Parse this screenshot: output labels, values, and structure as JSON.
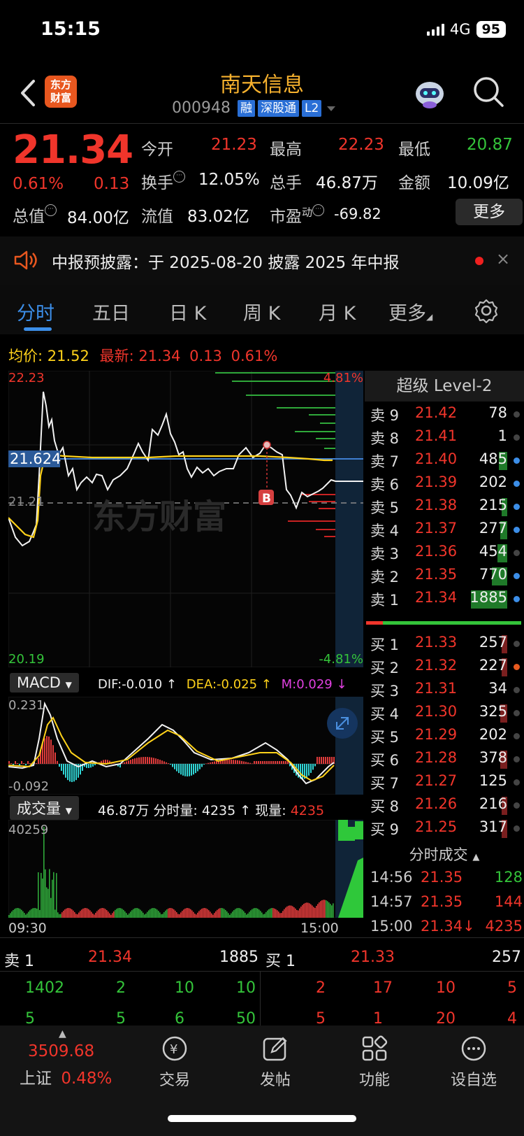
{
  "status": {
    "time": "15:15",
    "network": "4G",
    "battery": "95"
  },
  "header": {
    "logo_line1": "东方",
    "logo_line2": "财富",
    "stock_name": "南天信息",
    "stock_code": "000948",
    "tags": [
      "融",
      "深股通",
      "L2"
    ]
  },
  "quote": {
    "price": "21.34",
    "pct": "0.61%",
    "change": "0.13",
    "open_label": "今开",
    "open": "21.23",
    "high_label": "最高",
    "high": "22.23",
    "low_label": "最低",
    "low": "20.87",
    "turnover_label": "换手",
    "turnover": "12.05%",
    "vol_label": "总手",
    "vol": "46.87万",
    "amount_label": "金额",
    "amount": "10.09亿",
    "mktcap_label": "总值",
    "mktcap": "84.00亿",
    "float_label": "流值",
    "float": "83.02亿",
    "pe_label": "市盈",
    "pe_sup": "动",
    "pe": "-69.82",
    "more_label": "更多"
  },
  "notice": {
    "text": "中报预披露：于 2025-08-20 披露 2025 年中报",
    "close": "×"
  },
  "tabs": [
    "分时",
    "五日",
    "日 K",
    "周 K",
    "月 K",
    "更多"
  ],
  "stats": {
    "avg_label": "均价:",
    "avg": "21.52",
    "latest_label": "最新:",
    "latest": "21.34",
    "latest_chg": "0.13",
    "latest_pct": "0.61%"
  },
  "chart_labels": {
    "top_price": "22.23",
    "top_pct": "4.81%",
    "bottom_price": "20.19",
    "bottom_pct": "-4.81%",
    "marker_price": "21.624",
    "ref_price": "21.21",
    "marker_b": "B",
    "watermark": "东方财富"
  },
  "macd": {
    "name": "MACD",
    "dif": "DIF:-0.010 ↑",
    "dea": "DEA:-0.025 ↑",
    "m": "M:0.029 ↓",
    "top": "0.231",
    "bottom": "-0.092"
  },
  "volume": {
    "name": "成交量",
    "info": "46.87万 分时量: 4235 ↑ 现量:",
    "now": "4235",
    "max": "40259",
    "t_start": "09:30",
    "t_end": "15:00"
  },
  "orderbook": {
    "title": "超级 Level-2",
    "asks": [
      {
        "label": "卖 9",
        "price": "21.42",
        "vol": "78"
      },
      {
        "label": "卖 8",
        "price": "21.41",
        "vol": "1"
      },
      {
        "label": "卖 7",
        "price": "21.40",
        "vol": "485"
      },
      {
        "label": "卖 6",
        "price": "21.39",
        "vol": "202"
      },
      {
        "label": "卖 5",
        "price": "21.38",
        "vol": "215"
      },
      {
        "label": "卖 4",
        "price": "21.37",
        "vol": "277"
      },
      {
        "label": "卖 3",
        "price": "21.36",
        "vol": "454"
      },
      {
        "label": "卖 2",
        "price": "21.35",
        "vol": "770"
      },
      {
        "label": "卖 1",
        "price": "21.34",
        "vol": "1885"
      }
    ],
    "bids": [
      {
        "label": "买 1",
        "price": "21.33",
        "vol": "257"
      },
      {
        "label": "买 2",
        "price": "21.32",
        "vol": "227"
      },
      {
        "label": "买 3",
        "price": "21.31",
        "vol": "34"
      },
      {
        "label": "买 4",
        "price": "21.30",
        "vol": "325"
      },
      {
        "label": "买 5",
        "price": "21.29",
        "vol": "202"
      },
      {
        "label": "买 6",
        "price": "21.28",
        "vol": "378"
      },
      {
        "label": "买 7",
        "price": "21.27",
        "vol": "125"
      },
      {
        "label": "买 8",
        "price": "21.26",
        "vol": "216"
      },
      {
        "label": "买 9",
        "price": "21.25",
        "vol": "317"
      }
    ],
    "trades_title": "分时成交",
    "trades": [
      {
        "time": "14:56",
        "price": "21.35",
        "vol": "128"
      },
      {
        "time": "14:57",
        "price": "21.35",
        "vol": "144"
      },
      {
        "time": "15:00",
        "price": "21.34↓",
        "vol": "4235"
      }
    ]
  },
  "depth": {
    "sell_label": "卖 1",
    "sell_price": "21.34",
    "sell_vol": "1885",
    "buy_label": "买 1",
    "buy_price": "21.33",
    "buy_vol": "257",
    "sell_rows": [
      [
        "1402",
        "2",
        "10",
        "10"
      ],
      [
        "5",
        "5",
        "6",
        "50"
      ]
    ],
    "buy_rows": [
      [
        "2",
        "17",
        "10",
        "5"
      ],
      [
        "5",
        "1",
        "20",
        "4"
      ]
    ]
  },
  "bottom_nav": {
    "index_value": "3509.68",
    "index_name": "上证",
    "index_pct": "0.48%",
    "items": [
      "交易",
      "发帖",
      "功能",
      "设自选"
    ]
  },
  "colors": {
    "up": "#f0352b",
    "down": "#34c43a",
    "accent": "#3c8ee8",
    "avg_line": "#ffd21a"
  },
  "icons": [
    "back-icon",
    "search-icon",
    "speaker-icon",
    "gear-icon",
    "trade-icon",
    "post-icon",
    "function-icon",
    "more-icon"
  ]
}
